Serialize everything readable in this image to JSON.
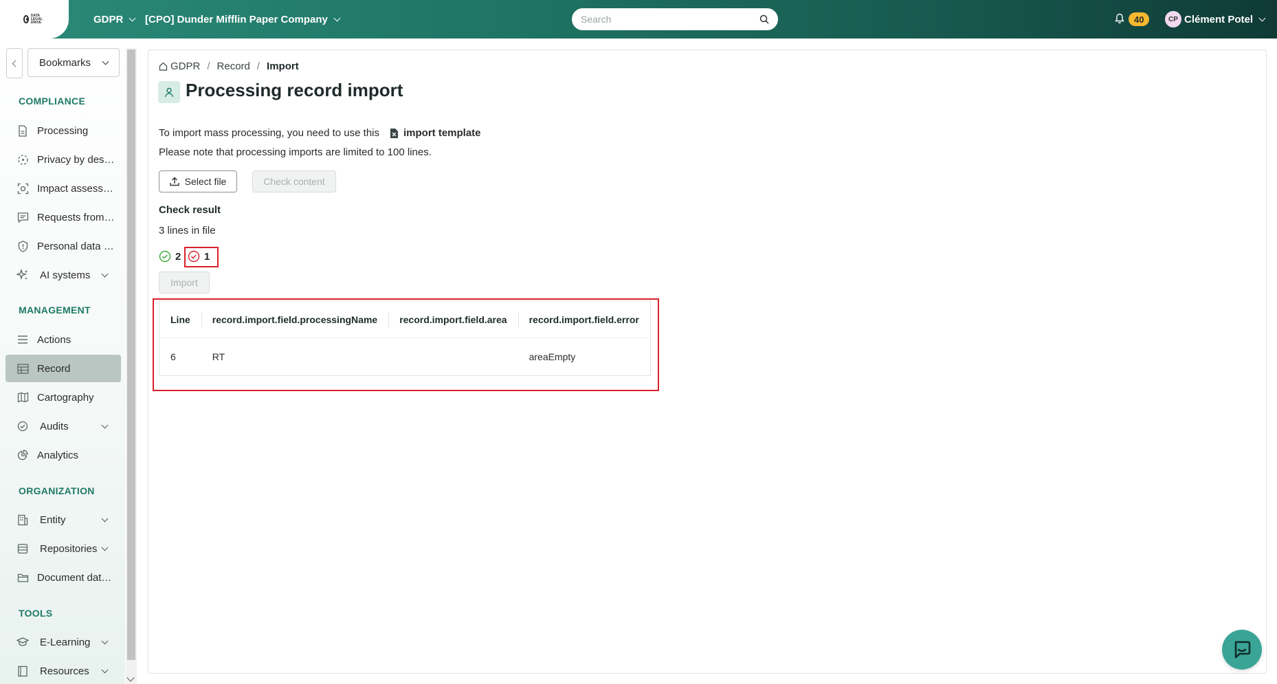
{
  "topbar": {
    "logo_text": "DATA LEGAL DRIVE",
    "module": "GDPR",
    "company": "[CPO] Dunder Mifflin Paper Company",
    "search_placeholder": "Search",
    "notifications_count": "40",
    "user_initials": "CP",
    "user_name": "Clément Potel"
  },
  "sidebar": {
    "bookmarks_label": "Bookmarks",
    "sections": {
      "compliance": "COMPLIANCE",
      "management": "MANAGEMENT",
      "organization": "ORGANIZATION",
      "tools": "TOOLS"
    },
    "items": {
      "processing": "Processing",
      "privacy_by_design": "Privacy by design",
      "impact_assessment": "Impact assessment",
      "requests": "Requests from data subjects",
      "data_breach": "Personal data breaches",
      "ai_systems": "AI systems",
      "actions": "Actions",
      "record": "Record",
      "cartography": "Cartography",
      "audits": "Audits",
      "analytics": "Analytics",
      "entity": "Entity",
      "repositories": "Repositories",
      "document_database": "Document database",
      "elearning": "E-Learning",
      "resources": "Resources"
    },
    "active_item": "record"
  },
  "breadcrumb": {
    "home": "GDPR",
    "level1": "Record",
    "current": "Import"
  },
  "page": {
    "title": "Processing record import",
    "intro_text": "To import mass processing, you need to use this",
    "template_link": "import template",
    "limit_note": "Please note that processing imports are limited to 100 lines.",
    "select_file_label": "Select file",
    "check_content_label": "Check content",
    "check_result_title": "Check result",
    "lines_in_file": "3 lines in file",
    "valid_count": "2",
    "error_count": "1",
    "import_label": "Import"
  },
  "error_table": {
    "headers": [
      "Line",
      "record.import.field.processingName",
      "record.import.field.area",
      "record.import.field.error"
    ],
    "rows": [
      [
        "6",
        "RT",
        "",
        "areaEmpty"
      ]
    ]
  },
  "colors": {
    "brand": "#1f7464",
    "accent_section": "#1f7a66",
    "highlight": "#d9202a",
    "badge": "#f5b82e",
    "success": "#3aa93a",
    "error": "#d9202a"
  }
}
